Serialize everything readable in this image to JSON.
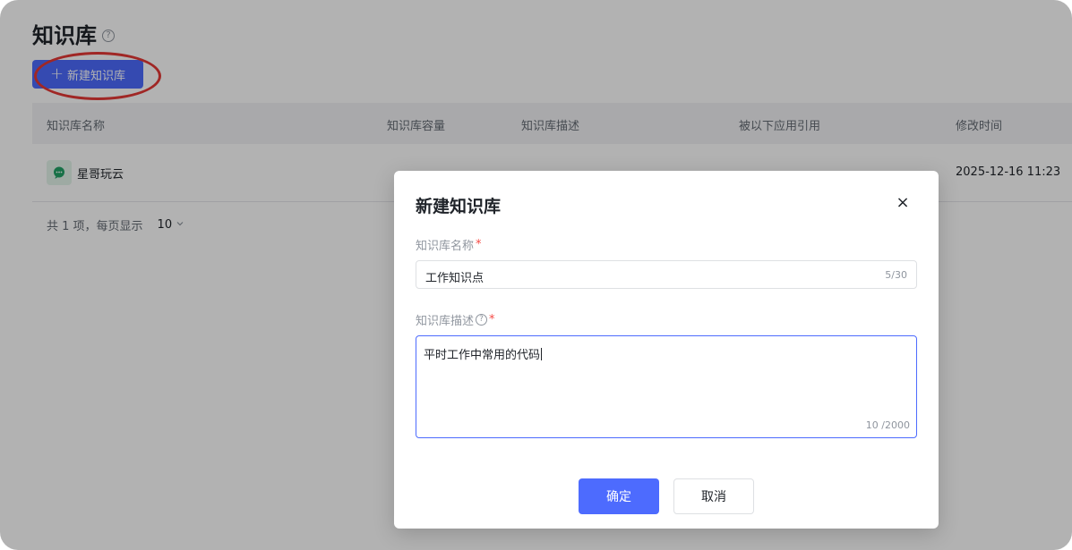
{
  "page": {
    "title": "知识库",
    "help_icon": "?",
    "new_button_label": "新建知识库",
    "new_button_icon": "+"
  },
  "table": {
    "headers": [
      "知识库名称",
      "知识库容量",
      "知识库描述",
      "被以下应用引用",
      "修改时间"
    ],
    "rows": [
      {
        "name": "星哥玩云",
        "capacity": "",
        "description": "",
        "referenced_by": "",
        "modified": "2025-12-16 11:23",
        "icon": "chat-bubble-icon"
      }
    ]
  },
  "pagination": {
    "summary": "共 1 项，每页显示",
    "page_size": "10"
  },
  "modal": {
    "title": "新建知识库",
    "close_symbol": "×",
    "name_label": "知识库名称",
    "name_value": "工作知识点",
    "name_counter": "5/30",
    "desc_label": "知识库描述",
    "desc_value": "平时工作中常用的代码",
    "desc_counter": "10 /2000",
    "required_mark": "*",
    "ok_label": "确定",
    "cancel_label": "取消"
  },
  "colors": {
    "primary": "#4d6bfe",
    "highlight": "#e53935",
    "chat_icon": "#21a366"
  }
}
